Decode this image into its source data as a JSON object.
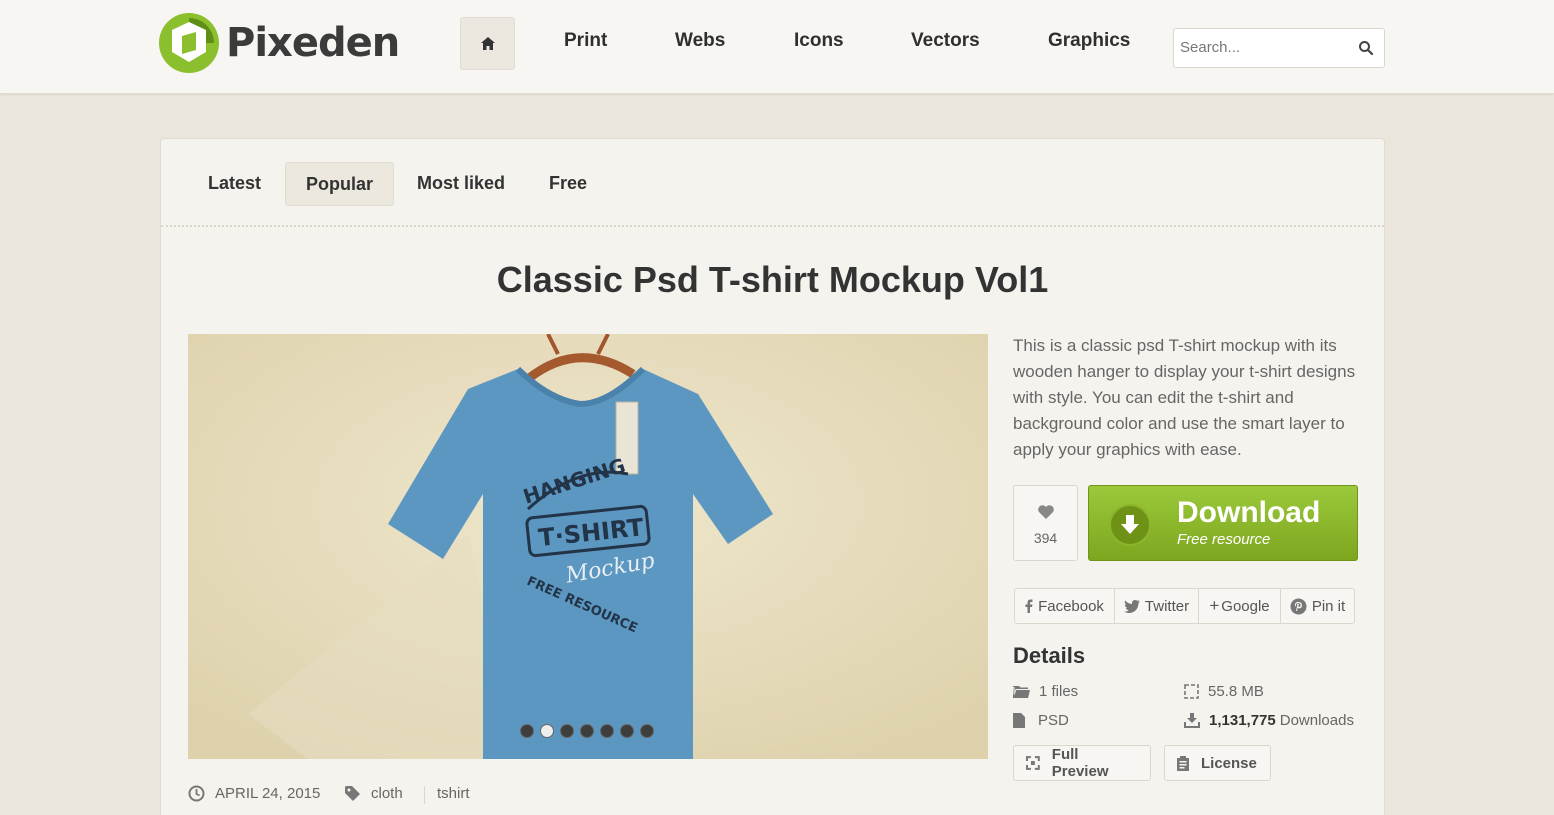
{
  "header": {
    "logo_text": "Pixeden",
    "nav": [
      "Print",
      "Webs",
      "Icons",
      "Vectors",
      "Graphics"
    ],
    "search_placeholder": "Search..."
  },
  "tabs": [
    {
      "label": "Latest",
      "active": false
    },
    {
      "label": "Popular",
      "active": true
    },
    {
      "label": "Most liked",
      "active": false
    },
    {
      "label": "Free",
      "active": false
    }
  ],
  "product": {
    "title": "Classic Psd T-shirt Mockup Vol1",
    "description": "This is a classic psd T-shirt mockup with its wooden hanger to display your t-shirt designs with style. You can edit the t-shirt and background color and use the smart layer to apply your graphics with ease.",
    "likes": "394",
    "download_label": "Download",
    "download_sub": "Free resource",
    "slides": 7,
    "active_slide": 2,
    "shirt_color": "#5b97c1"
  },
  "share": {
    "facebook": "Facebook",
    "twitter": "Twitter",
    "google": "Google",
    "pinterest": "Pin it"
  },
  "details": {
    "heading": "Details",
    "files": "1 files",
    "size": "55.8 MB",
    "format": "PSD",
    "downloads_count": "1,131,775",
    "downloads_label": "Downloads"
  },
  "actions": {
    "full_preview": "Full Preview",
    "license": "License"
  },
  "meta": {
    "date": "APRIL 24, 2015",
    "tags": [
      "cloth",
      "tshirt"
    ]
  },
  "colors": {
    "accent_green": "#8bb92c",
    "background": "#ebe6dc"
  }
}
